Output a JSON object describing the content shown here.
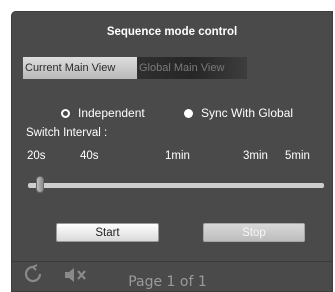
{
  "panel": {
    "title": "Sequence mode control"
  },
  "tabs": [
    {
      "label": "Current Main View",
      "active": true
    },
    {
      "label": "Global Main View",
      "active": false
    }
  ],
  "mode": {
    "options": [
      {
        "label": "Independent",
        "selected": true
      },
      {
        "label": "Sync With Global",
        "selected": false
      }
    ]
  },
  "interval": {
    "label": "Switch Interval :",
    "ticks": [
      "20s",
      "40s",
      "1min",
      "3min",
      "5min"
    ],
    "selected": "20s"
  },
  "buttons": {
    "start_label": "Start",
    "stop_label": "Stop"
  },
  "footer": {
    "refresh_icon": "refresh-icon",
    "mute_icon": "mute-icon",
    "page_info": "Page 1 of 1"
  },
  "colors": {
    "panel_bg": "#4a4a4a",
    "text": "#ffffff",
    "muted_text": "#9a9a9a"
  }
}
